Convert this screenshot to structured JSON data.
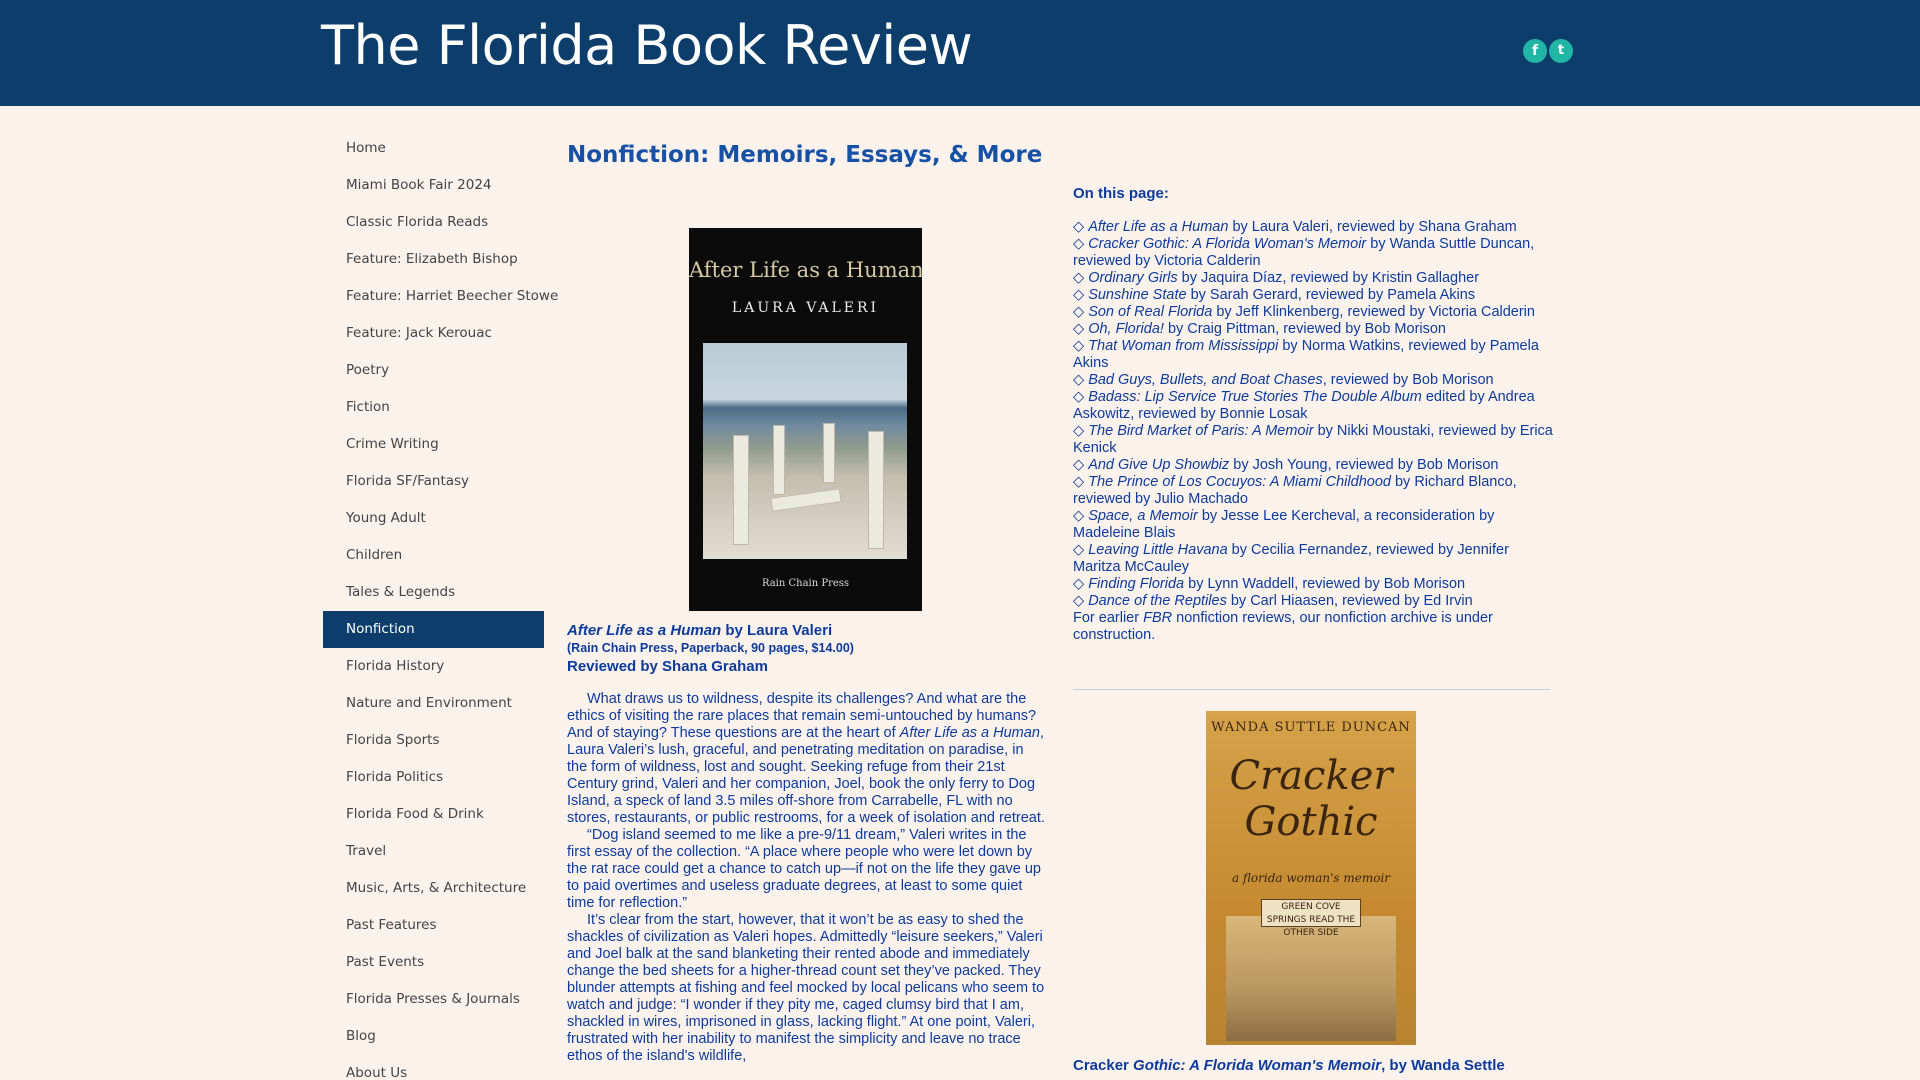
{
  "header": {
    "site_title": "The Florida Book Review",
    "social": [
      {
        "icon": "facebook-icon",
        "glyph": "f"
      },
      {
        "icon": "twitter-icon",
        "glyph": "t"
      }
    ]
  },
  "sidebar": {
    "items": [
      {
        "label": "Home"
      },
      {
        "label": "Miami Book Fair 2024"
      },
      {
        "label": "Classic Florida Reads"
      },
      {
        "label": "Feature: Elizabeth Bishop"
      },
      {
        "label": "Feature: Harriet Beecher Stowe"
      },
      {
        "label": "Feature: Jack Kerouac"
      },
      {
        "label": "Poetry"
      },
      {
        "label": "Fiction"
      },
      {
        "label": "Crime Writing"
      },
      {
        "label": "Florida SF/Fantasy"
      },
      {
        "label": "Young Adult"
      },
      {
        "label": "Children"
      },
      {
        "label": "Tales & Legends"
      },
      {
        "label": "Nonfiction",
        "active": true
      },
      {
        "label": "Florida History"
      },
      {
        "label": "Nature and Environment"
      },
      {
        "label": "Florida Sports"
      },
      {
        "label": "Florida Politics"
      },
      {
        "label": "Florida Food & Drink"
      },
      {
        "label": "Travel"
      },
      {
        "label": "Music, Arts, & Architecture"
      },
      {
        "label": "Past Features"
      },
      {
        "label": "Past Events"
      },
      {
        "label": "Florida Presses & Journals"
      },
      {
        "label": "Blog"
      },
      {
        "label": "About Us"
      }
    ]
  },
  "main": {
    "page_title": "Nonfiction: Memoirs, Essays, & More",
    "cover1": {
      "title": "After Life as a Human",
      "author": "LAURA VALERI",
      "publisher": "Rain Chain Press"
    },
    "review": {
      "book_title": "After Life as a Human",
      "by_author": " by Laura Valeri",
      "pub_info": "(Rain Chain Press, Paperback, 90 pages, $14.00)",
      "reviewer": "Reviewed by Shana Graham",
      "paragraphs": [
        {
          "before": "What draws us to wildness, despite its challenges? And what are the ethics of visiting the rare places that remain semi-untouched by humans? And of staying? These questions are at the heart of ",
          "italic": "After Life as a Human",
          "after": ", Laura Valeri’s lush, graceful, and penetrating meditation on paradise, in the form of wildness, lost and sought. Seeking refuge from their 21st Century grind, Valeri and her companion, Joel, book the only ferry to Dog Island, a speck of land 3.5 miles off-shore from Carrabelle, FL with no stores, restaurants, or public restrooms, for a week of isolation and retreat."
        },
        {
          "before": "“Dog island seemed to me like a pre-9/11 dream,” Valeri writes in the first essay of the collection. “A place where people who were let down by the rat race could get a chance to catch up—if not on the life they gave up to paid overtimes and useless graduate degrees, at least to some quiet time for reflection.”",
          "italic": "",
          "after": ""
        },
        {
          "before": "It’s clear from the start, however, that it won’t be as easy to shed the shackles of civilization as Valeri hopes. Admittedly “leisure seekers,” Valeri and Joel balk at the sand blanketing their rented abode and immediately change the bed sheets for a higher-thread count set they’ve packed. They blunder attempts at fishing and feel mocked by local pelicans who seem to watch and judge: “I wonder if they pity me, caged clumsy bird that I am, shackled in wires, imprisoned in glass, lacking flight.” At one point, Valeri, frustrated with her inability to manifest the simplicity and leave no trace ethos of the island's wildlife,",
          "italic": "",
          "after": ""
        }
      ]
    },
    "toc": {
      "heading": "On this page:",
      "entries": [
        {
          "italic": "After Life as a Human",
          "rest": " by Laura Valeri, reviewed by Shana Graham"
        },
        {
          "italic": "Cracker Gothic: A Florida Woman's Memoir",
          "rest": " by Wanda Suttle Duncan, reviewed by Victoria Calderin"
        },
        {
          "italic": "Ordinary Girls",
          "rest": " by Jaquira Díaz, reviewed by Kristin Gallagher"
        },
        {
          "italic": "Sunshine State",
          "rest": " by Sarah Gerard, reviewed by Pamela Akins"
        },
        {
          "italic": "Son of Real Florida",
          "rest": " by Jeff Klinkenberg, reviewed by Victoria Calderin"
        },
        {
          "italic": "Oh, Florida!",
          "rest": " by Craig Pittman, reviewed by Bob Morison"
        },
        {
          "italic": "That Woman from Mississippi",
          "rest": " by Norma Watkins, reviewed by Pamela Akins"
        },
        {
          "italic": "Bad Guys, Bullets, and Boat Chases",
          "rest": ", reviewed by Bob Morison"
        },
        {
          "italic": "Badass: Lip Service True Stories The Double Album",
          "rest": " edited by Andrea Askowitz, reviewed by Bonnie Losak"
        },
        {
          "italic": "The Bird Market of Paris: A Memoir",
          "rest": " by Nikki Moustaki, reviewed by Erica Kenick"
        },
        {
          "italic": "And Give Up Showbiz",
          "rest": " by Josh Young, reviewed by Bob Morison"
        },
        {
          "italic": "The Prince of Los Cocuyos: A Miami Childhood",
          "rest": " by Richard Blanco, reviewed by Julio Machado"
        },
        {
          "italic": "Space, a Memoir",
          "rest": " by Jesse Lee Kercheval, a reconsideration by Madeleine Blais"
        },
        {
          "italic": "Leaving Little Havana",
          "rest": " by Cecilia Fernandez, reviewed by Jennifer Maritza McCauley"
        },
        {
          "italic": "Finding Florida",
          "rest": " by Lynn Waddell, reviewed by Bob Morison"
        },
        {
          "italic": "Dance of the Reptiles",
          "rest": " by Carl Hiaasen, reviewed by Ed Irvin"
        }
      ],
      "bullet": "◇",
      "footer_before": "For earlier ",
      "footer_italic": "FBR",
      "footer_after": " nonfiction reviews, our nonfiction archive is under construction."
    },
    "cover2": {
      "author": "WANDA SUTTLE DUNCAN",
      "title_line1": "Cracker",
      "title_line2": "Gothic",
      "subtitle": "a florida woman's memoir",
      "sign": "GREEN COVE SPRINGS READ THE OTHER SIDE"
    },
    "review2": {
      "title_prefix": "Cracker ",
      "title_italic": "Gothic: A Florida Woman's Memoir",
      "by_author": ", by Wanda Settle"
    }
  },
  "colors": {
    "header_bg": "#0d3d6b",
    "page_bg": "#fbf2ec",
    "link_blue": "#0d3a9e",
    "social_teal": "#21b5a6"
  }
}
